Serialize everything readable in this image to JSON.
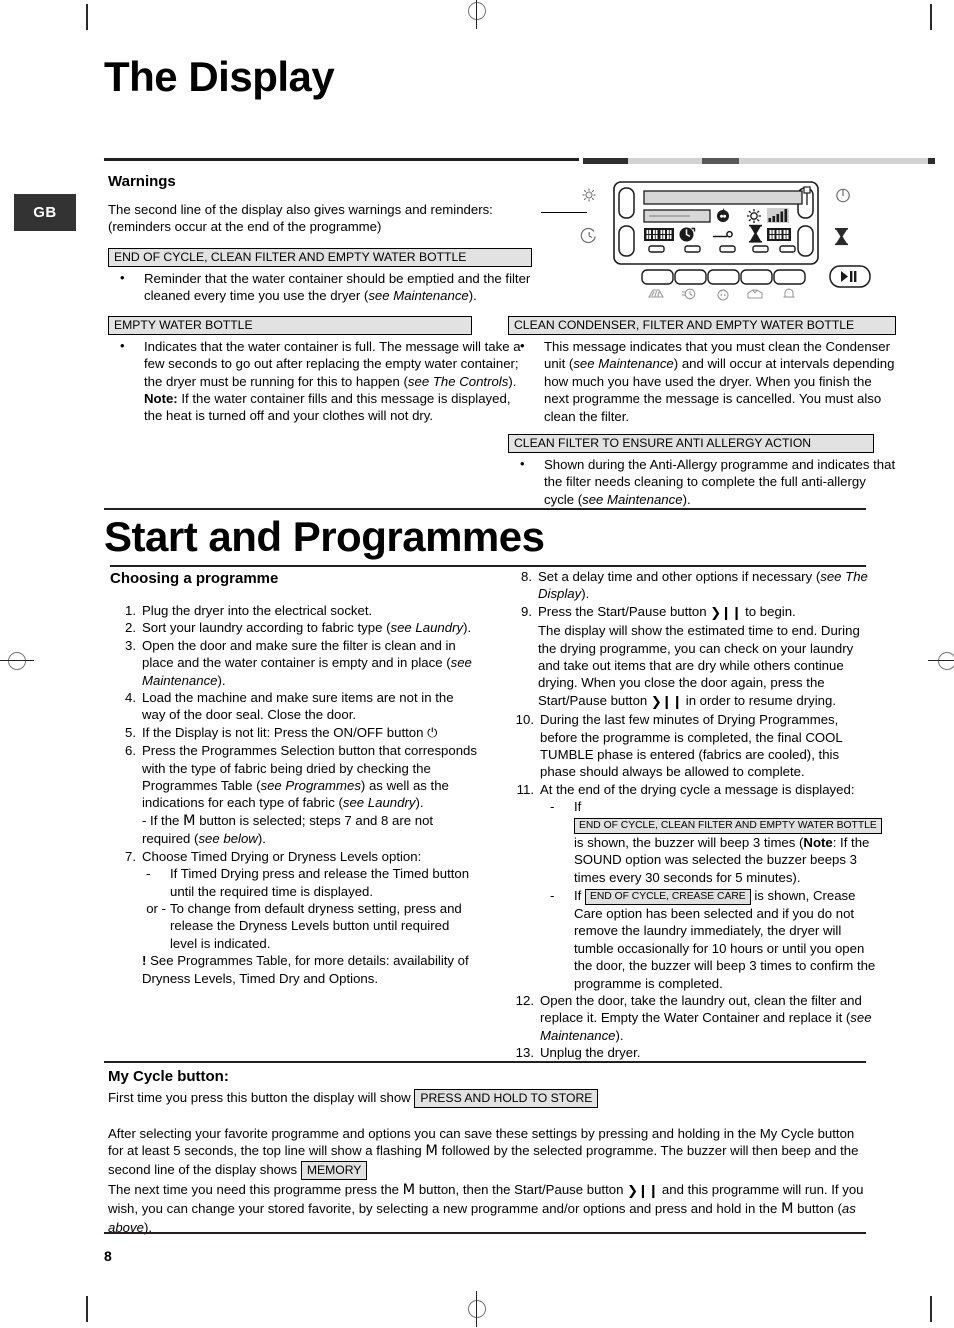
{
  "page": {
    "locale_tag": "GB",
    "page_number": "8"
  },
  "display_section": {
    "title": "The Display",
    "warnings_heading": "Warnings",
    "intro_line1": "The second line of the display also gives warnings and reminders:",
    "intro_line2": "(reminders occur at the end of the programme)",
    "messages": [
      {
        "box": "END OF CYCLE, CLEAN FILTER AND EMPTY WATER BOTTLE",
        "bullet_html": "Reminder that the water container should be emptied and the filter cleaned every time you use the dryer (<i>see Maintenance</i>)."
      },
      {
        "box": "EMPTY WATER BOTTLE",
        "bullet_html": "Indicates that the water container is full. The message will take a few seconds to go out after replacing the empty water container; the dryer must be running for this to happen (<i>see The Controls</i>).<br><b>Note:</b> If the water container fills and this message is displayed, the heat is turned off and your clothes will not dry."
      },
      {
        "box": "CLEAN CONDENSER, FILTER AND EMPTY WATER BOTTLE",
        "bullet_html": "This message indicates that you must clean the Condenser unit (<i>see Maintenance</i>) and will occur at intervals depending how much you have used the dryer. When you finish the next programme the message is cancelled. You must also clean the filter."
      },
      {
        "box": "CLEAN FILTER TO ENSURE ANTI ALLERGY ACTION",
        "bullet_html": "Shown during the Anti-Allergy programme and indicates that the filter needs cleaning to complete the full anti-allergy cycle (<i>see Maintenance</i>)."
      }
    ]
  },
  "panel_graphic": {
    "icons": [
      "sun-icon",
      "delayed-start-icon",
      "crease-care-icon",
      "power-icon",
      "hourglass-icon",
      "anti-allergy-icon",
      "timer-icon",
      "key-lock-icon",
      "signal-bars-icon",
      "flame-icon",
      "start-pause-icon"
    ],
    "button_icons": [
      "cotton-icon",
      "timed-icon",
      "baby-icon",
      "shirts-icon",
      "quick-icon"
    ],
    "start_pause_label": "❯❙❙"
  },
  "start_section": {
    "title": "Start and Programmes",
    "choosing_heading": "Choosing a programme",
    "steps_left": [
      {
        "n": "1.",
        "html": "Plug the dryer into the electrical socket."
      },
      {
        "n": "2.",
        "html": "Sort your laundry according to fabric type (<i>see Laundry</i>)."
      },
      {
        "n": "3.",
        "html": "Open the door and make sure the filter is clean and in place and the water container is empty and in place (<i>see Maintenance</i>)."
      },
      {
        "n": "4.",
        "html": "Load the machine and make sure items are not in the way of the door seal. Close the door."
      },
      {
        "n": "5.",
        "html": "If the Display is not lit: Press the ON/OFF button <span class=\"sym\">&#9211;</span>"
      },
      {
        "n": "6.",
        "html": "Press the Programmes Selection button that corresponds with the type of fabric being dried by checking the Programmes Table (<i>see Programmes</i>) as well as the indications for each type of fabric (<i>see Laundry</i>).<br>- If the <span class=\"sym-m\">M</span> button is selected; steps 7 and 8 are not required (<i>see below</i>)."
      }
    ],
    "step7": {
      "n": "7.",
      "intro": "Choose Timed Drying or Dryness Levels option:",
      "sub": [
        {
          "dash": "-",
          "html": "If Timed Drying press and release the Timed button until the required time is displayed."
        },
        {
          "dash": "or -",
          "html": "To change from default dryness setting, press and release the Dryness Levels button until required level is indicated."
        }
      ],
      "note_html": "<b>!</b> See Programmes Table, for more details: availability of Dryness Levels, Timed Dry and Options."
    },
    "steps_right": [
      {
        "n": "8.",
        "html": "Set a delay time and other options if necessary (<i>see The Display</i>)."
      },
      {
        "n": "9.",
        "html": "Press the Start/Pause button <span class=\"startpause\">&#10095;&#10073;&#10073;</span> to begin.<br>The display will show the estimated time to end. During the drying programme, you can check on your laundry and take out items that are dry while others continue drying. When you close the door again, press the Start/Pause button <span class=\"startpause\">&#10095;&#10073;&#10073;</span> in order to resume drying."
      },
      {
        "n": "10.",
        "html": "During the last few minutes of Drying Programmes, before the programme is completed, the final COOL TUMBLE phase is entered (fabrics are cooled), this phase should always be allowed to complete."
      }
    ],
    "step11": {
      "n": "11.",
      "intro": "At the end of the drying cycle a message is displayed:",
      "sub": [
        {
          "dash": "-",
          "pre": "If",
          "box": "END OF CYCLE, CLEAN FILTER AND EMPTY WATER BOTTLE",
          "post_html": "is shown, the buzzer will beep 3 times (<b>Note</b>: If the SOUND option was selected the buzzer beeps 3 times every 30 seconds for 5 minutes)."
        },
        {
          "dash": "-",
          "pre": "If",
          "box": "END OF CYCLE, CREASE CARE",
          "post_html": "is shown, Crease Care option has been selected and if you do not remove the laundry immediately, the dryer will tumble occasionally for 10 hours or until you open the door, the buzzer will beep 3 times to confirm the programme is completed."
        }
      ]
    },
    "steps_right_tail": [
      {
        "n": "12.",
        "html": "Open the door, take the laundry out, clean the filter and replace it. Empty the Water Container and replace it (<i>see Maintenance</i>)."
      },
      {
        "n": "13.",
        "html": "Unplug the dryer."
      }
    ]
  },
  "my_cycle": {
    "heading": "My Cycle button:",
    "first_line_pre": "First time you press this button the display will show",
    "first_line_box": "PRESS AND HOLD TO STORE",
    "para_html": "After selecting your favorite programme and options you can save these settings by pressing and holding in the My Cycle button for at least 5 seconds, the top line will show a flashing <span class=\"sym-m\">M</span> followed by the selected programme. The buzzer will then beep and the second line of the display shows",
    "memory_box": "MEMORY",
    "para2_html": "The next time you need this programme press the <span class=\"sym-m\">M</span> button, then the Start/Pause button <span class=\"startpause\">&#10095;&#10073;&#10073;</span> and this programme will run. If you wish, you can change your stored favorite, by selecting a new programme and/or options and press and hold in the <span class=\"sym-m\">M</span> button (<i>as above</i>)."
  }
}
